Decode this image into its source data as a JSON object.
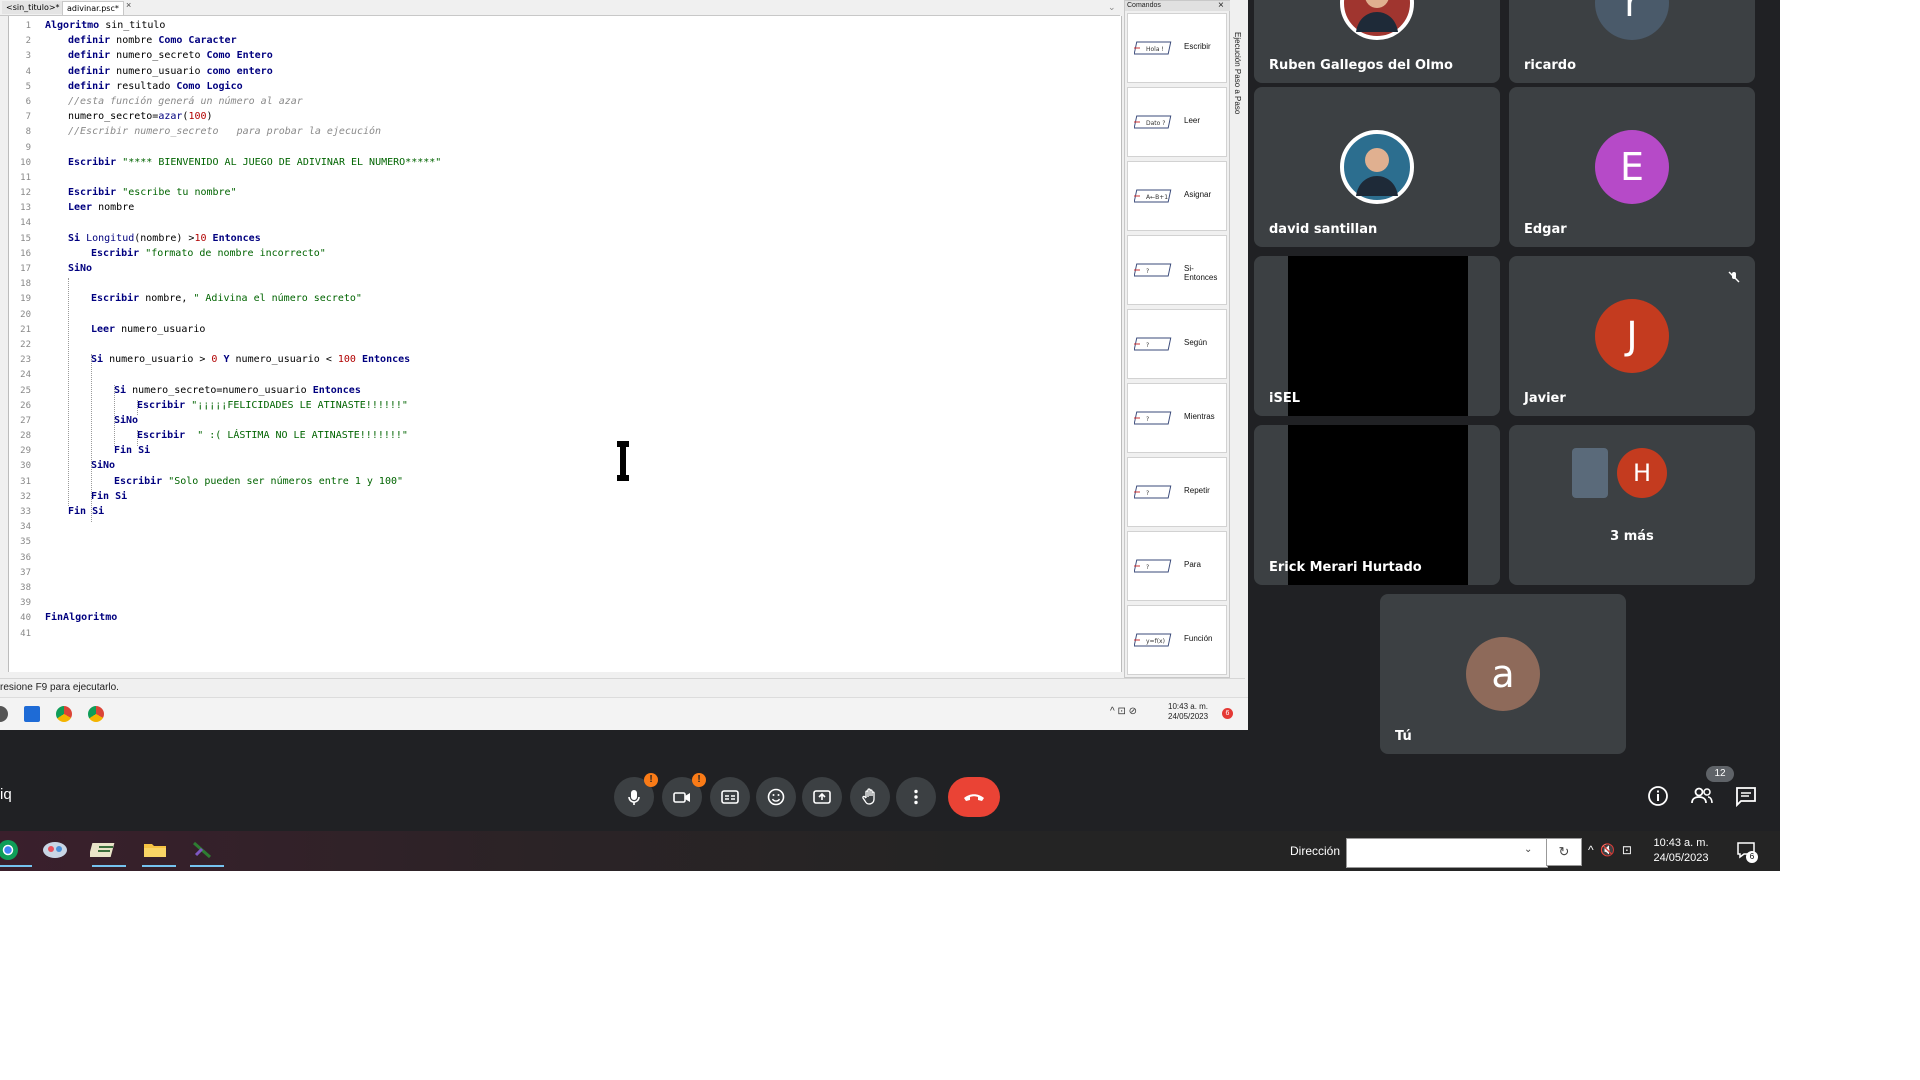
{
  "editor": {
    "tabs": [
      "<sin_titulo>*",
      "adivinar.psc*"
    ],
    "tab_close": "×",
    "status": "resione F9 para ejecutarlo.",
    "lines": [
      {
        "n": "1",
        "i": 0,
        "t": [
          [
            "k",
            "Algoritmo"
          ],
          [
            "p",
            " sin_titulo"
          ]
        ]
      },
      {
        "n": "2",
        "i": 1,
        "t": [
          [
            "k",
            "definir"
          ],
          [
            "p",
            " nombre "
          ],
          [
            "k",
            "Como Caracter"
          ]
        ]
      },
      {
        "n": "3",
        "i": 1,
        "t": [
          [
            "k",
            "definir"
          ],
          [
            "p",
            " numero_secreto "
          ],
          [
            "k",
            "Como Entero"
          ]
        ]
      },
      {
        "n": "4",
        "i": 1,
        "t": [
          [
            "k",
            "definir"
          ],
          [
            "p",
            " numero_usuario "
          ],
          [
            "k",
            "como entero"
          ]
        ]
      },
      {
        "n": "5",
        "i": 1,
        "t": [
          [
            "k",
            "definir"
          ],
          [
            "p",
            " resultado "
          ],
          [
            "k",
            "Como Logico"
          ]
        ]
      },
      {
        "n": "6",
        "i": 1,
        "t": [
          [
            "c",
            "//esta función generá un número al azar"
          ]
        ]
      },
      {
        "n": "7",
        "i": 1,
        "t": [
          [
            "p",
            "numero_secreto="
          ],
          [
            "f",
            "azar"
          ],
          [
            "p",
            "("
          ],
          [
            "n",
            "100"
          ],
          [
            "p",
            ")"
          ]
        ]
      },
      {
        "n": "8",
        "i": 1,
        "t": [
          [
            "c",
            "//Escribir numero_secreto   para probar la ejecución"
          ]
        ]
      },
      {
        "n": "9",
        "i": 0,
        "t": []
      },
      {
        "n": "10",
        "i": 1,
        "t": [
          [
            "k",
            "Escribir"
          ],
          [
            "p",
            " "
          ],
          [
            "s",
            "\"**** BIENVENIDO AL JUEGO DE ADIVINAR EL NUMERO*****\""
          ]
        ]
      },
      {
        "n": "11",
        "i": 0,
        "t": []
      },
      {
        "n": "12",
        "i": 1,
        "t": [
          [
            "k",
            "Escribir"
          ],
          [
            "p",
            " "
          ],
          [
            "s",
            "\"escribe tu nombre\""
          ]
        ]
      },
      {
        "n": "13",
        "i": 1,
        "t": [
          [
            "k",
            "Leer"
          ],
          [
            "p",
            " nombre"
          ]
        ]
      },
      {
        "n": "14",
        "i": 0,
        "t": []
      },
      {
        "n": "15",
        "i": 1,
        "t": [
          [
            "k",
            "Si"
          ],
          [
            "p",
            " "
          ],
          [
            "f",
            "Longitud"
          ],
          [
            "p",
            "(nombre) >"
          ],
          [
            "n",
            "10"
          ],
          [
            "p",
            " "
          ],
          [
            "k",
            "Entonces"
          ]
        ]
      },
      {
        "n": "16",
        "i": 2,
        "t": [
          [
            "k",
            "Escribir"
          ],
          [
            "p",
            " "
          ],
          [
            "s",
            "\"formato de nombre incorrecto\""
          ]
        ]
      },
      {
        "n": "17",
        "i": 1,
        "t": [
          [
            "k",
            "SiNo"
          ]
        ]
      },
      {
        "n": "18",
        "i": 0,
        "t": []
      },
      {
        "n": "19",
        "i": 2,
        "t": [
          [
            "k",
            "Escribir"
          ],
          [
            "p",
            " nombre, "
          ],
          [
            "s",
            "\" Adivina el número secreto\""
          ]
        ]
      },
      {
        "n": "20",
        "i": 0,
        "t": []
      },
      {
        "n": "21",
        "i": 2,
        "t": [
          [
            "k",
            "Leer"
          ],
          [
            "p",
            " numero_usuario"
          ]
        ]
      },
      {
        "n": "22",
        "i": 0,
        "t": []
      },
      {
        "n": "23",
        "i": 2,
        "t": [
          [
            "k",
            "Si"
          ],
          [
            "p",
            " numero_usuario > "
          ],
          [
            "n",
            "0"
          ],
          [
            "p",
            " "
          ],
          [
            "k",
            "Y"
          ],
          [
            "p",
            " numero_usuario < "
          ],
          [
            "n",
            "100"
          ],
          [
            "p",
            " "
          ],
          [
            "k",
            "Entonces"
          ]
        ]
      },
      {
        "n": "24",
        "i": 0,
        "t": []
      },
      {
        "n": "25",
        "i": 3,
        "t": [
          [
            "k",
            "Si"
          ],
          [
            "p",
            " numero_secreto=numero_usuario "
          ],
          [
            "k",
            "Entonces"
          ]
        ]
      },
      {
        "n": "26",
        "i": 4,
        "t": [
          [
            "k",
            "Escribir"
          ],
          [
            "p",
            " "
          ],
          [
            "s",
            "\"¡¡¡¡¡FELICIDADES LE ATINASTE!!!!!!\""
          ]
        ]
      },
      {
        "n": "27",
        "i": 3,
        "t": [
          [
            "k",
            "SiNo"
          ]
        ]
      },
      {
        "n": "28",
        "i": 4,
        "t": [
          [
            "k",
            "Escribir"
          ],
          [
            "p",
            "  "
          ],
          [
            "s",
            "\" :( LÁSTIMA NO LE ATINASTE!!!!!!!\""
          ]
        ]
      },
      {
        "n": "29",
        "i": 3,
        "t": [
          [
            "k",
            "Fin Si"
          ]
        ]
      },
      {
        "n": "30",
        "i": 2,
        "t": [
          [
            "k",
            "SiNo"
          ]
        ]
      },
      {
        "n": "31",
        "i": 3,
        "t": [
          [
            "k",
            "Escribir"
          ],
          [
            "p",
            " "
          ],
          [
            "s",
            "\"Solo pueden ser números entre 1 y 100\""
          ]
        ]
      },
      {
        "n": "32",
        "i": 2,
        "t": [
          [
            "k",
            "Fin Si"
          ]
        ]
      },
      {
        "n": "33",
        "i": 1,
        "t": [
          [
            "k",
            "Fin Si"
          ]
        ]
      },
      {
        "n": "34",
        "i": 0,
        "t": []
      },
      {
        "n": "35",
        "i": 0,
        "t": []
      },
      {
        "n": "36",
        "i": 0,
        "t": []
      },
      {
        "n": "37",
        "i": 0,
        "t": []
      },
      {
        "n": "38",
        "i": 0,
        "t": []
      },
      {
        "n": "39",
        "i": 0,
        "t": []
      },
      {
        "n": "40",
        "i": 0,
        "t": [
          [
            "k",
            "FinAlgoritmo"
          ]
        ]
      },
      {
        "n": "41",
        "i": 0,
        "t": []
      }
    ]
  },
  "commands": {
    "title": "Comandos",
    "close": "×",
    "side_label": "Ejecución Paso a Paso",
    "items": [
      {
        "label": "Escribir",
        "glyph": "Hola !"
      },
      {
        "label": "Leer",
        "glyph": "Dato ?"
      },
      {
        "label": "Asignar",
        "glyph": "A←B+1"
      },
      {
        "label": "Si-Entonces",
        "glyph": "?"
      },
      {
        "label": "Según",
        "glyph": "?"
      },
      {
        "label": "Mientras",
        "glyph": "?"
      },
      {
        "label": "Repetir",
        "glyph": "?"
      },
      {
        "label": "Para",
        "glyph": "?"
      },
      {
        "label": "Función",
        "glyph": "y=f(x)"
      }
    ]
  },
  "mini_taskbar": {
    "time": "10:43 a. m.",
    "date": "24/05/2023",
    "badge": "6",
    "tray": "^ ⊡ ⊘"
  },
  "participants": [
    {
      "name": "Ruben Gallegos del Olmo",
      "type": "photo",
      "color": "#a0352f"
    },
    {
      "name": "ricardo",
      "type": "letter",
      "letter": "r",
      "color": "#4a5a6a"
    },
    {
      "name": "david santillan",
      "type": "photo",
      "color": "#2c6e8f"
    },
    {
      "name": "Edgar",
      "type": "letter",
      "letter": "E",
      "color": "#b64ac8"
    },
    {
      "name": "iSEL",
      "type": "video"
    },
    {
      "name": "Javier",
      "type": "letter",
      "letter": "J",
      "color": "#c43b1f",
      "muted": true
    },
    {
      "name": "Erick Merari Hurtado",
      "type": "video"
    },
    {
      "name": "3 más",
      "type": "more",
      "letter": "H",
      "color": "#c43b1f"
    },
    {
      "name": "Tú",
      "type": "letter",
      "letter": "a",
      "color": "#8e6a5a"
    }
  ],
  "meet_toolbar": {
    "left_text": "iq",
    "people_count": "12",
    "warn": "!"
  },
  "win_taskbar": {
    "address_label": "Dirección",
    "address_value": "",
    "time": "10:43 a. m.",
    "date": "24/05/2023",
    "notif": "6"
  }
}
